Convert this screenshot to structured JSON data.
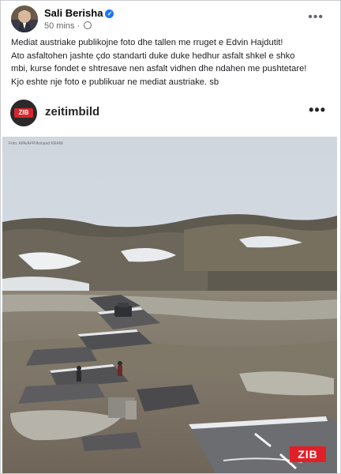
{
  "post": {
    "author": "Sali Berisha",
    "time": "50 mins",
    "separator": "·",
    "menu": "•••",
    "text_lines": [
      "Mediat austriake publikojne foto dhe tallen me rruget e Edvin Hajdutit!",
      "Ato asfaltohen jashte çdo standarti duke duke hedhur asfalt shkel e shko",
      "mbi, kurse fondet e shtresave nen asfalt vidhen dhe ndahen me pushtetare!",
      "Kjo eshte nje foto e publikuar ne mediat austriake. sb"
    ]
  },
  "embed": {
    "account": "zeitimbild",
    "avatar_badge": "ZIB",
    "menu": "•••",
    "photo_credit": "Foto: APA/AFP/Armand KRANI",
    "watermark": "ZIB"
  },
  "colors": {
    "verified": "#1877f2",
    "zib_red": "#e21f26",
    "meta_gray": "#65676b"
  }
}
